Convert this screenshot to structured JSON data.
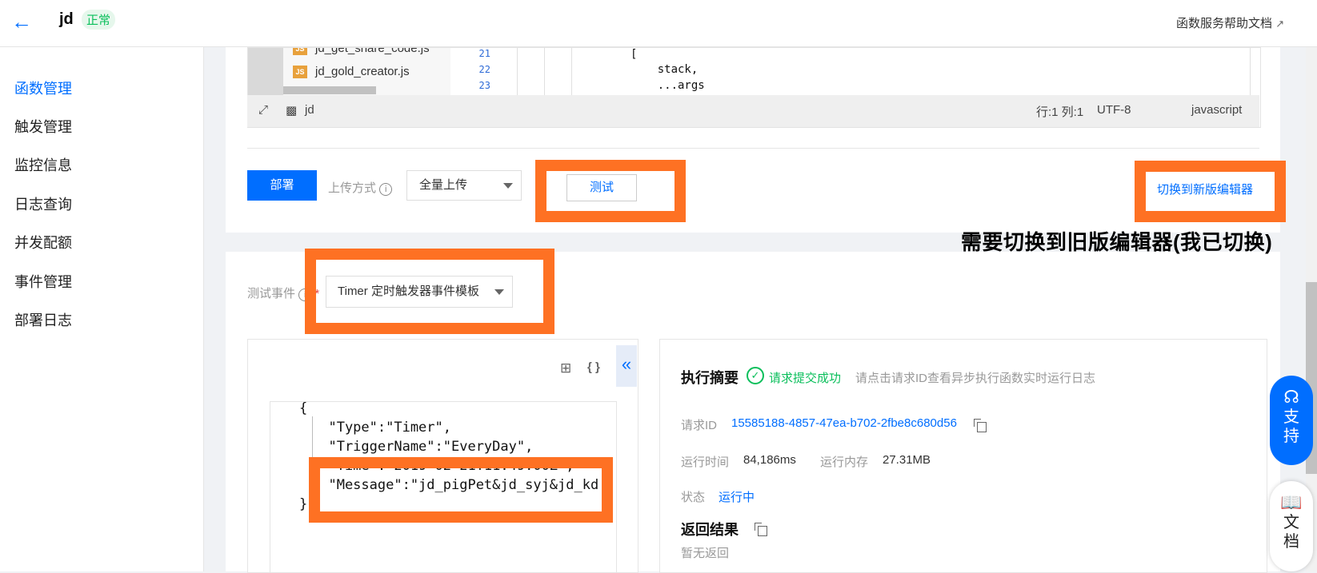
{
  "header": {
    "back_icon": "arrow-left-icon",
    "title": "jd",
    "status": "正常",
    "help_link": "函数服务帮助文档"
  },
  "sidebar": {
    "items": [
      "函数管理",
      "触发管理",
      "监控信息",
      "日志查询",
      "并发配额",
      "事件管理",
      "部署日志"
    ],
    "active_index": 0
  },
  "editor": {
    "files": [
      "jd_get_share_code.js",
      "jd_gold_creator.js"
    ],
    "line_numbers": [
      "21",
      "22",
      "23"
    ],
    "code_lines": [
      "[",
      "    stack,",
      "    ...args"
    ],
    "footer": {
      "folder": "jd",
      "position": "行:1 列:1",
      "encoding": "UTF-8",
      "language": "javascript"
    }
  },
  "actions": {
    "deploy": "部署",
    "upload_label": "上传方式",
    "upload_value": "全量上传",
    "test": "测试",
    "switch_editor": "切换到新版编辑器"
  },
  "annotation": "需要切换到旧版编辑器(我已切换)",
  "test_event": {
    "label": "测试事件",
    "required_mark": "*",
    "selected": "Timer 定时触发器事件模板",
    "json_lines": [
      "{",
      "  \"Type\":\"Timer\",",
      "  \"TriggerName\":\"EveryDay\",",
      "  \"Time\":\"2019-02-21T11:49:00Z\",",
      "  \"Message\":\"jd_pigPet&jd_syj&jd_kd",
      "}"
    ]
  },
  "summary": {
    "title": "执行摘要",
    "success": "请求提交成功",
    "hint": "请点击请求ID查看异步执行函数实时运行日志",
    "request_id_label": "请求ID",
    "request_id": "15585188-4857-47ea-b702-2fbe8c680d56",
    "run_time_label": "运行时间",
    "run_time": "84,186ms",
    "memory_label": "运行内存",
    "memory": "27.31MB",
    "state_label": "状态",
    "state": "运行中",
    "result_title": "返回结果",
    "result": "暂无返回"
  },
  "float": {
    "support": [
      "支",
      "持"
    ],
    "docs": [
      "文",
      "档"
    ]
  },
  "colors": {
    "primary": "#006eff",
    "highlight": "#fe7123",
    "success": "#0abf5b"
  }
}
